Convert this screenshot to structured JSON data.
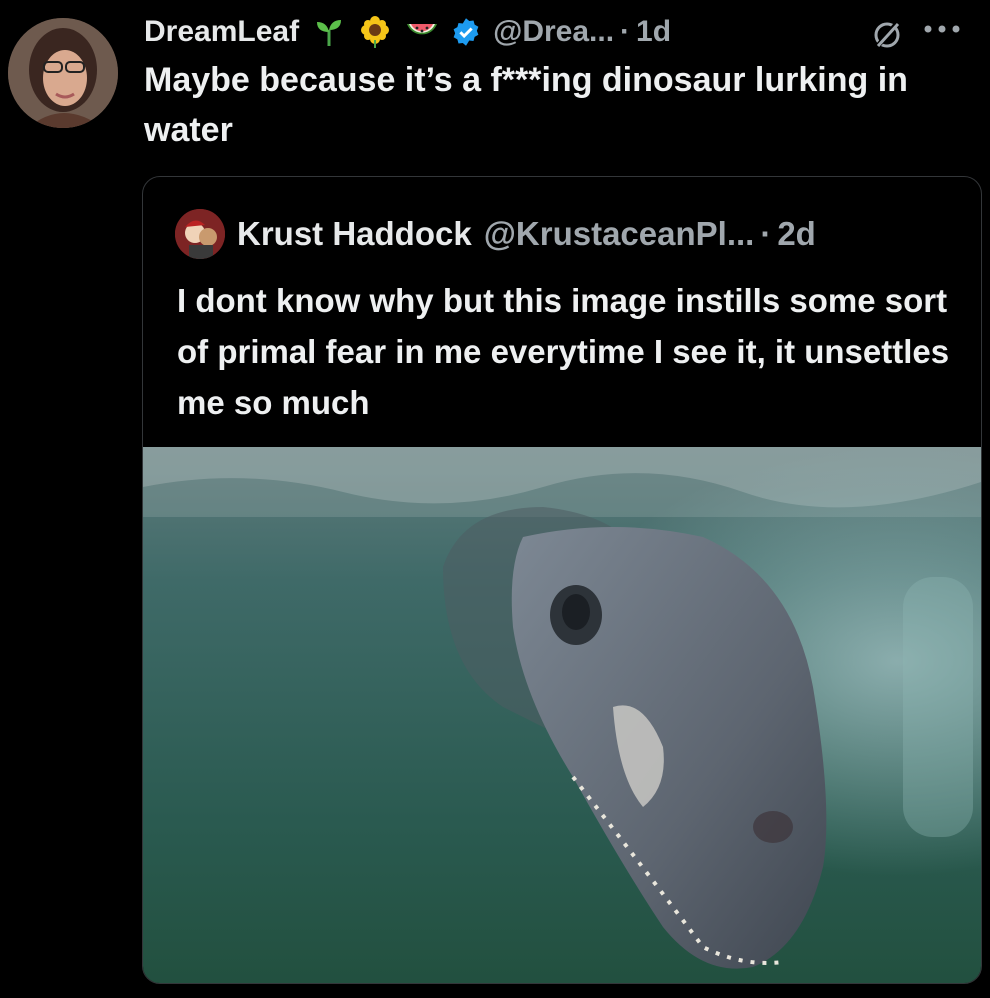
{
  "tweet": {
    "display_name": "DreamLeaf",
    "handle": "@Drea...",
    "separator": "·",
    "age": "1d",
    "text_before": "Maybe because it’s a ",
    "text_censored": "f***ing",
    "text_after": " dinosaur lurking in water",
    "emojis": [
      "seedling",
      "sunflower",
      "watermelon"
    ],
    "verified": true
  },
  "quoted_tweet": {
    "display_name": "Krust Haddock",
    "handle": "@KrustaceanPl...",
    "separator": "·",
    "age": "2d",
    "text": "I dont know why but this image instills some sort of primal fear in me everytime I see it, it unsettles me so much",
    "media": "photo of a plesiosaur-like creature head underwater"
  },
  "icons": {
    "verified": "verified-badge-icon",
    "grok": "grok-icon",
    "more": "more-options-icon"
  },
  "colors": {
    "background": "#000000",
    "text": "#e7e9ea",
    "secondary": "#a0a7ad",
    "verified": "#1d9bf0",
    "border": "#333639"
  }
}
